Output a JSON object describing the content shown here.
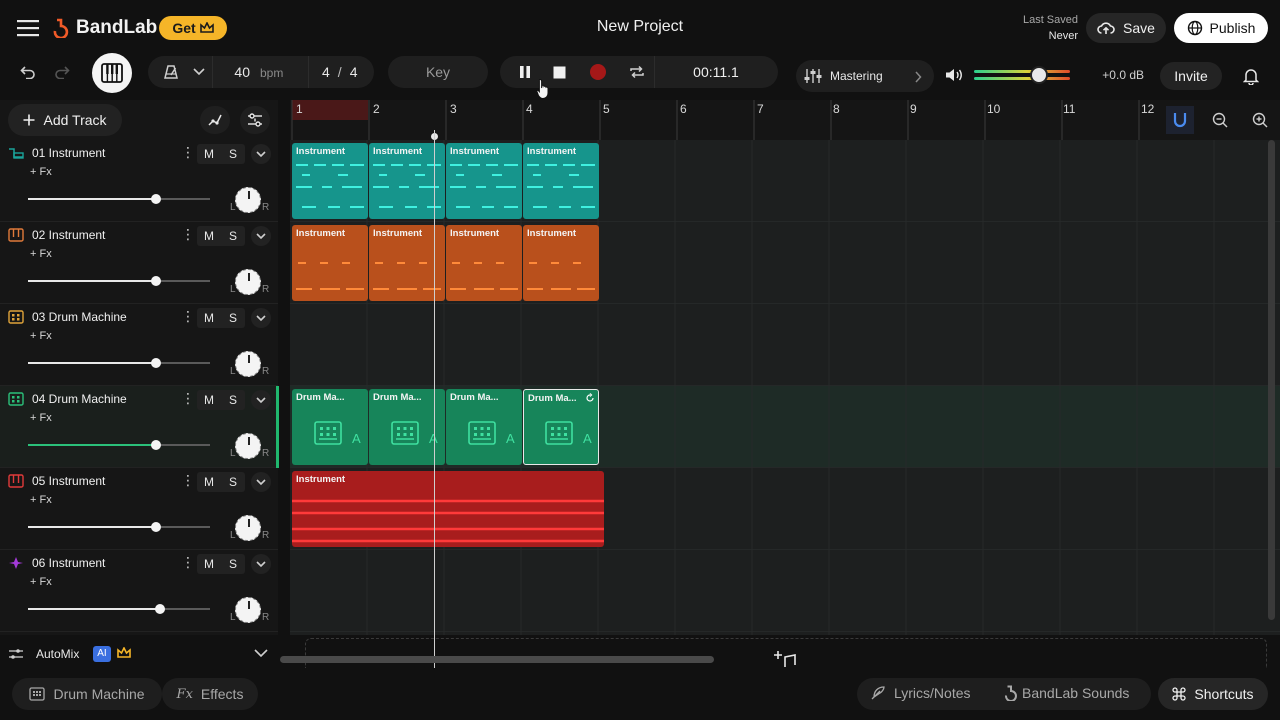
{
  "header": {
    "brand": "BandLab",
    "get_label": "Get",
    "project_title": "New Project",
    "last_saved_label": "Last Saved",
    "last_saved_value": "Never",
    "save_label": "Save",
    "publish_label": "Publish"
  },
  "toolbar": {
    "bpm_value": "40",
    "bpm_unit": "bpm",
    "time_sig_num": "4",
    "time_sig_sep": "/",
    "time_sig_den": "4",
    "key_label": "Key",
    "time_display": "00:11.1",
    "mastering_label": "Mastering",
    "db_label": "+0.0 dB",
    "invite_label": "Invite"
  },
  "sidebar": {
    "add_track_label": "Add Track",
    "tracks": [
      {
        "name": "01  Instrument",
        "fx": "+ Fx",
        "m": "M",
        "s": "S",
        "l": "L",
        "r": "R",
        "volume": 0.7
      },
      {
        "name": "02  Instrument",
        "fx": "+ Fx",
        "m": "M",
        "s": "S",
        "l": "L",
        "r": "R",
        "volume": 0.7
      },
      {
        "name": "03  Drum Machine",
        "fx": "+ Fx",
        "m": "M",
        "s": "S",
        "l": "L",
        "r": "R",
        "volume": 0.7
      },
      {
        "name": "04  Drum Machine",
        "fx": "+ Fx",
        "m": "M",
        "s": "S",
        "l": "L",
        "r": "R",
        "volume": 0.7
      },
      {
        "name": "05  Instrument",
        "fx": "+ Fx",
        "m": "M",
        "s": "S",
        "l": "L",
        "r": "R",
        "volume": 0.7
      },
      {
        "name": "06  Instrument",
        "fx": "+ Fx",
        "m": "M",
        "s": "S",
        "l": "L",
        "r": "R",
        "volume": 0.72
      }
    ],
    "automix_label": "AutoMix",
    "automix_ai": "AI"
  },
  "timeline": {
    "bars": [
      "1",
      "2",
      "3",
      "4",
      "5",
      "6",
      "7",
      "8",
      "9",
      "10",
      "11",
      "12"
    ],
    "clip_labels": {
      "instrument": "Instrument",
      "drum": "Drum Ma...",
      "drum_letter": "A"
    }
  },
  "bottom": {
    "drum_machine_label": "Drum Machine",
    "effects_prefix": "Fx",
    "effects_label": "Effects",
    "lyrics_label": "Lyrics/Notes",
    "sounds_label": "BandLab Sounds",
    "shortcuts_label": "Shortcuts"
  },
  "colors": {
    "teal": "#1aa39a",
    "orange": "#c5561f",
    "green": "#18895d",
    "red": "#c92020",
    "accent_gold": "#f5b528"
  }
}
